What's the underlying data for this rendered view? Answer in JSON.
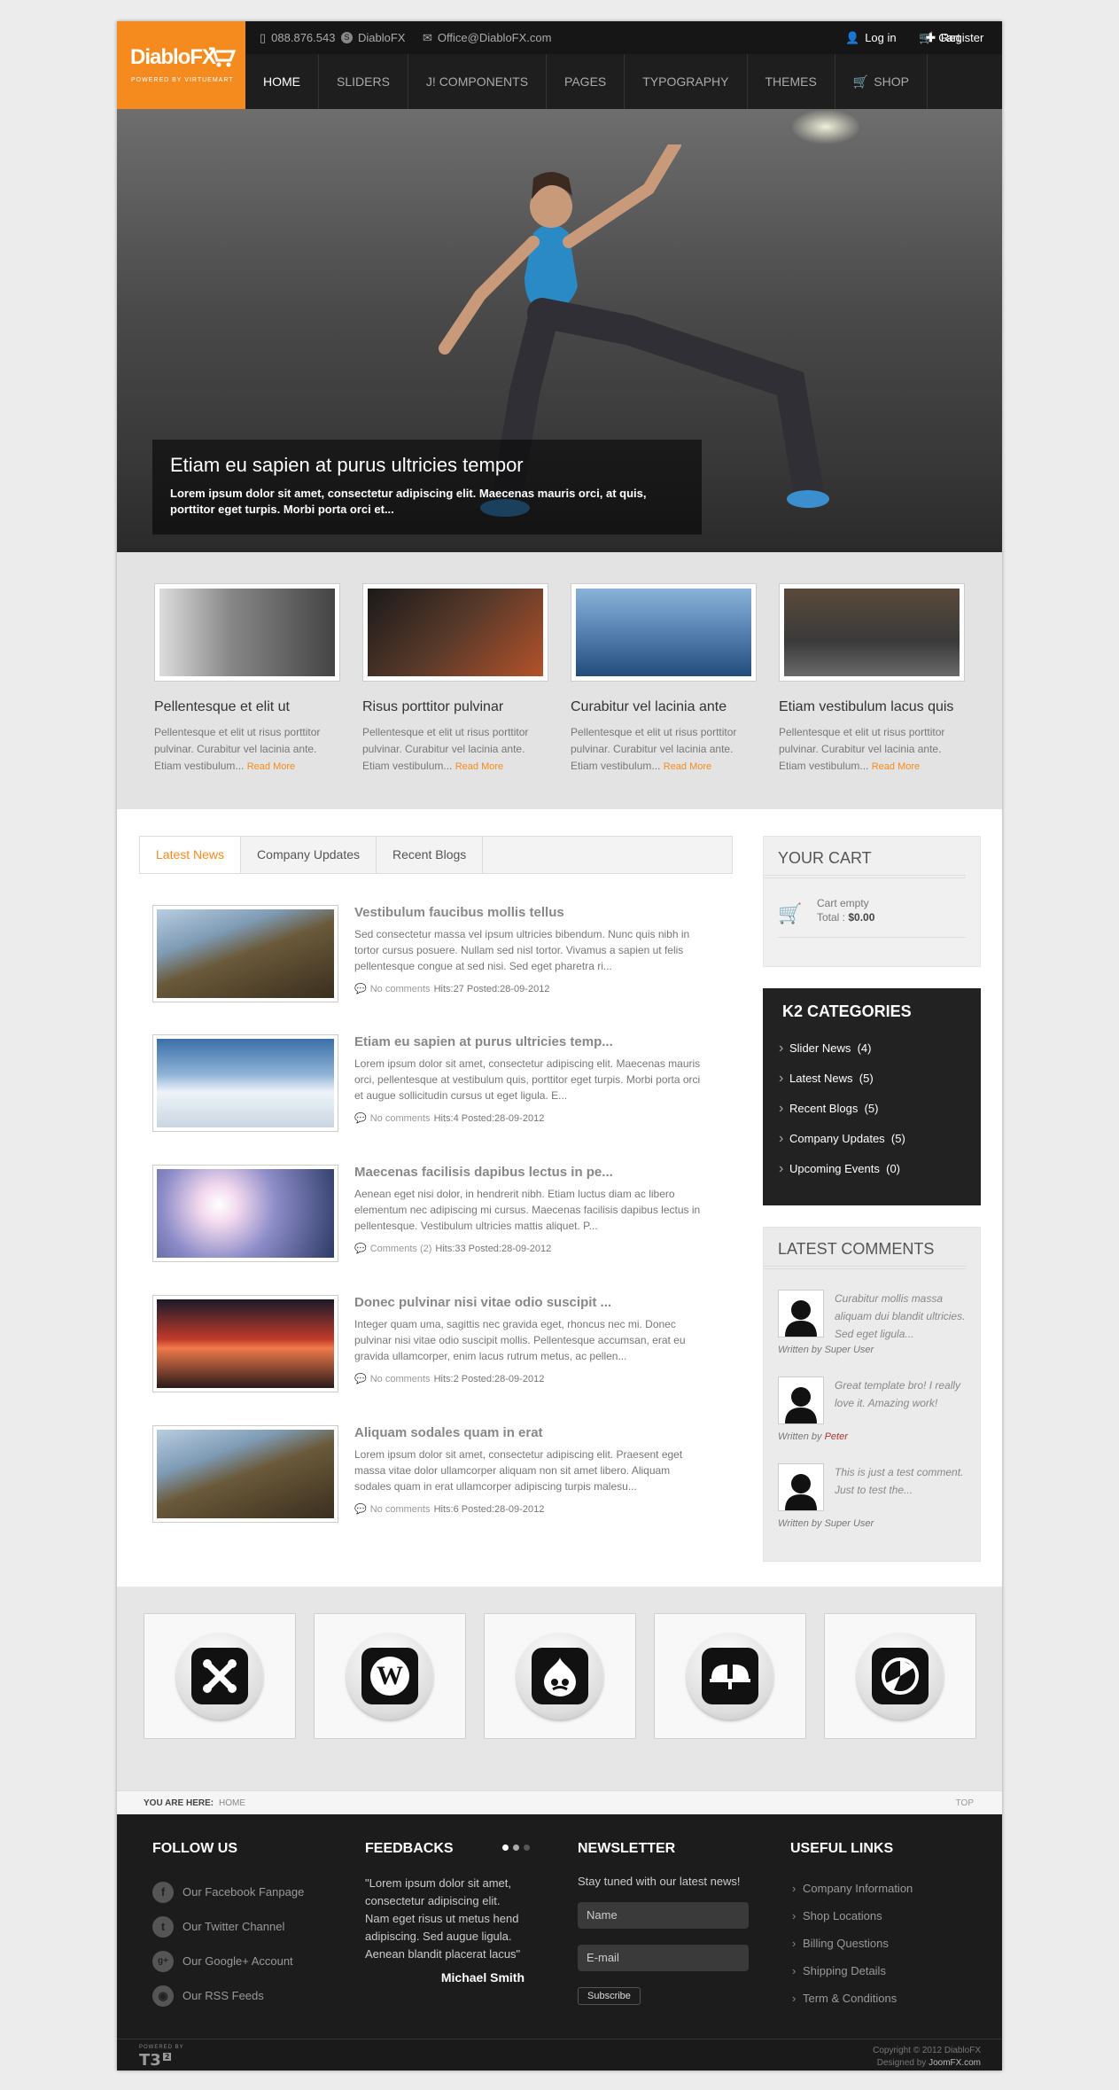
{
  "header": {
    "logo": "DiabloFX",
    "logo_sub": "POWERED BY VIRTUEMART",
    "phone": "088.876.543",
    "skype": "DiabloFX",
    "email": "Office@DiabloFX.com",
    "cart": "Cart",
    "login": "Log in",
    "register": "Register"
  },
  "nav": [
    "HOME",
    "SLIDERS",
    "J! COMPONENTS",
    "PAGES",
    "TYPOGRAPHY",
    "THEMES",
    "SHOP"
  ],
  "hero": {
    "title": "Etiam eu sapien at purus ultricies tempor",
    "text": "Lorem ipsum dolor sit amet, consectetur adipiscing elit. Maecenas mauris orci, at quis, porttitor eget turpis. Morbi porta orci et..."
  },
  "features": [
    {
      "title": "Pellentesque et elit ut",
      "text": "Pellentesque et elit ut risus porttitor pulvinar. Curabitur vel lacinia ante. Etiam vestibulum...",
      "more": "Read More"
    },
    {
      "title": "Risus porttitor pulvinar",
      "text": "Pellentesque et elit ut risus porttitor pulvinar. Curabitur vel lacinia ante. Etiam vestibulum...",
      "more": "Read More"
    },
    {
      "title": "Curabitur vel lacinia ante",
      "text": "Pellentesque et elit ut risus porttitor pulvinar. Curabitur vel lacinia ante. Etiam vestibulum...",
      "more": "Read More"
    },
    {
      "title": "Etiam vestibulum lacus quis",
      "text": "Pellentesque et elit ut risus porttitor pulvinar. Curabitur vel lacinia ante. Etiam vestibulum...",
      "more": "Read More"
    }
  ],
  "tabs": [
    "Latest News",
    "Company Updates",
    "Recent Blogs"
  ],
  "articles": [
    {
      "title": "Vestibulum faucibus mollis tellus",
      "text": "Sed consectetur massa vel ipsum ultricies bibendum. Nunc quis nibh in tortor cursus posuere. Nullam sed nisl tortor. Vivamus a sapien ut felis pellentesque congue at sed nisi. Sed eget pharetra ri...",
      "comments": "No comments",
      "meta": "Hits:27 Posted:28-09-2012"
    },
    {
      "title": "Etiam eu sapien at purus ultricies temp...",
      "text": "Lorem ipsum dolor sit amet, consectetur adipiscing elit. Maecenas mauris orci, pellentesque at vestibulum quis, porttitor eget turpis. Morbi porta orci et augue sollicitudin cursus ut eget ligula. E...",
      "comments": "No comments",
      "meta": "Hits:4 Posted:28-09-2012"
    },
    {
      "title": "Maecenas facilisis dapibus lectus in pe...",
      "text": "Aenean eget nisi dolor, in hendrerit nibh. Etiam luctus diam ac libero elementum nec adipiscing mi cursus. Maecenas facilisis dapibus lectus in pellentesque. Vestibulum ultricies mattis aliquet. P...",
      "comments": "Comments (2)",
      "meta": "Hits:33 Posted:28-09-2012"
    },
    {
      "title": "Donec pulvinar nisi vitae odio suscipit ...",
      "text": "Integer quam uma, sagittis nec gravida eget, rhoncus nec mi. Donec pulvinar nisi vitae odio suscipit mollis. Pellentesque accumsan, erat eu gravida ullamcorper, enim lacus rutrum metus, ac pellen...",
      "comments": "No comments",
      "meta": "Hits:2 Posted:28-09-2012"
    },
    {
      "title": "Aliquam sodales quam in erat",
      "text": "Lorem ipsum dolor sit amet, consectetur adipiscing elit. Praesent eget massa vitae dolor ullamcorper aliquam non sit amet libero. Aliquam sodales quam in erat ullamcorper adipiscing turpis malesu...",
      "comments": "No comments",
      "meta": "Hits:6 Posted:28-09-2012"
    }
  ],
  "cart": {
    "title": "YOUR CART",
    "empty": "Cart empty",
    "total_label": "Total :",
    "total": "$0.00"
  },
  "k2": {
    "title": "K2 CATEGORIES",
    "items": [
      {
        "label": "Slider News",
        "count": "(4)"
      },
      {
        "label": "Latest News",
        "count": "(5)"
      },
      {
        "label": "Recent Blogs",
        "count": "(5)"
      },
      {
        "label": "Company Updates",
        "count": "(5)"
      },
      {
        "label": "Upcoming Events",
        "count": "(0)"
      }
    ]
  },
  "latest_comments": {
    "title": "LATEST COMMENTS",
    "items": [
      {
        "text": "Curabitur mollis massa aliquam dui blandit ultricies. Sed eget ligula...",
        "by": "Written by",
        "author": "Super User"
      },
      {
        "text": "Great template bro! I really love it. Amazing work!",
        "by": "Written by",
        "author": "Peter"
      },
      {
        "text": "This is just a test comment. Just to test the...",
        "by": "Written by",
        "author": "Super User"
      }
    ]
  },
  "partners": [
    "joomla-icon",
    "wordpress-icon",
    "drupal-icon",
    "deviantart-icon",
    "picasa-icon"
  ],
  "breadcrumb": {
    "label": "YOU ARE HERE:",
    "current": "HOME",
    "top": "TOP"
  },
  "footer": {
    "follow_title": "FOLLOW US",
    "follow": [
      {
        "icon": "f",
        "label": "Our Facebook Fanpage"
      },
      {
        "icon": "t",
        "label": "Our Twitter Channel"
      },
      {
        "icon": "g+",
        "label": "Our Google+ Account"
      },
      {
        "icon": "◉",
        "label": "Our RSS Feeds"
      }
    ],
    "feedback_title": "FEEDBACKS",
    "feedback_text": "\"Lorem ipsum dolor sit amet, consectetur adipiscing elit. Nam eget risus ut metus hend adipiscing. Sed augue ligula. Aenean blandit placerat lacus\"",
    "feedback_author": "Michael Smith",
    "newsletter_title": "NEWSLETTER",
    "newsletter_text": "Stay tuned with our latest news!",
    "name_placeholder": "Name",
    "email_placeholder": "E-mail",
    "subscribe": "Subscribe",
    "links_title": "USEFUL LINKS",
    "links": [
      "Company Information",
      "Shop Locations",
      "Billing Questions",
      "Shipping Details",
      "Term & Conditions"
    ],
    "powered": "POWERED BY",
    "copyright": "Copyright © 2012 DiabloFX",
    "designed_label": "Designed by",
    "designed_by": "JoomFX.com"
  }
}
